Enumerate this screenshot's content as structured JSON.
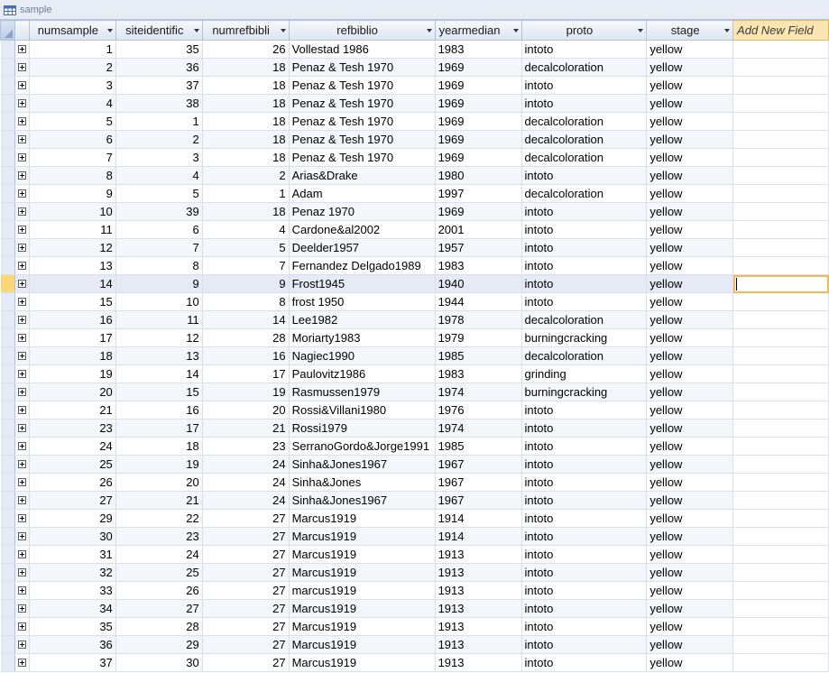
{
  "window": {
    "title": "sample"
  },
  "columns": [
    {
      "key": "numsample",
      "label": "numsample"
    },
    {
      "key": "siteidentific",
      "label": "siteidentific"
    },
    {
      "key": "numrefbibli",
      "label": "numrefbibli"
    },
    {
      "key": "refbiblio",
      "label": "refbiblio"
    },
    {
      "key": "yearmedian",
      "label": "yearmedian"
    },
    {
      "key": "proto",
      "label": "proto"
    },
    {
      "key": "stage",
      "label": "stage"
    }
  ],
  "add_field_label": "Add New Field",
  "current_row_index": 13,
  "colors": {
    "accent": "#fbd77a",
    "header": "#dce5f1",
    "add_field": "#fce5b0"
  },
  "rows": [
    [
      "1",
      "35",
      "26",
      "Vollestad 1986",
      "1983",
      "intoto",
      "yellow"
    ],
    [
      "2",
      "36",
      "18",
      "Penaz & Tesh 1970",
      "1969",
      "decalcoloration",
      "yellow"
    ],
    [
      "3",
      "37",
      "18",
      "Penaz & Tesh 1970",
      "1969",
      "intoto",
      "yellow"
    ],
    [
      "4",
      "38",
      "18",
      "Penaz & Tesh 1970",
      "1969",
      "intoto",
      "yellow"
    ],
    [
      "5",
      "1",
      "18",
      "Penaz & Tesh 1970",
      "1969",
      "decalcoloration",
      "yellow"
    ],
    [
      "6",
      "2",
      "18",
      "Penaz & Tesh 1970",
      "1969",
      "decalcoloration",
      "yellow"
    ],
    [
      "7",
      "3",
      "18",
      "Penaz & Tesh 1970",
      "1969",
      "decalcoloration",
      "yellow"
    ],
    [
      "8",
      "4",
      "2",
      "Arias&Drake",
      "1980",
      "intoto",
      "yellow"
    ],
    [
      "9",
      "5",
      "1",
      "Adam",
      "1997",
      "decalcoloration",
      "yellow"
    ],
    [
      "10",
      "39",
      "18",
      "Penaz 1970",
      "1969",
      "intoto",
      "yellow"
    ],
    [
      "11",
      "6",
      "4",
      "Cardone&al2002",
      "2001",
      "intoto",
      "yellow"
    ],
    [
      "12",
      "7",
      "5",
      "Deelder1957",
      "1957",
      "intoto",
      "yellow"
    ],
    [
      "13",
      "8",
      "7",
      "Fernandez Delgado1989",
      "1983",
      "intoto",
      "yellow"
    ],
    [
      "14",
      "9",
      "9",
      "Frost1945",
      "1940",
      "intoto",
      "yellow"
    ],
    [
      "15",
      "10",
      "8",
      "frost 1950",
      "1944",
      "intoto",
      "yellow"
    ],
    [
      "16",
      "11",
      "14",
      "Lee1982",
      "1978",
      "decalcoloration",
      "yellow"
    ],
    [
      "17",
      "12",
      "28",
      "Moriarty1983",
      "1979",
      "burningcracking",
      "yellow"
    ],
    [
      "18",
      "13",
      "16",
      "Nagiec1990",
      "1985",
      "decalcoloration",
      "yellow"
    ],
    [
      "19",
      "14",
      "17",
      "Paulovitz1986",
      "1983",
      "grinding",
      "yellow"
    ],
    [
      "20",
      "15",
      "19",
      "Rasmussen1979",
      "1974",
      "burningcracking",
      "yellow"
    ],
    [
      "21",
      "16",
      "20",
      "Rossi&Villani1980",
      "1976",
      "intoto",
      "yellow"
    ],
    [
      "23",
      "17",
      "21",
      "Rossi1979",
      "1974",
      "intoto",
      "yellow"
    ],
    [
      "24",
      "18",
      "23",
      "SerranoGordo&Jorge1991",
      "1985",
      "intoto",
      "yellow"
    ],
    [
      "25",
      "19",
      "24",
      "Sinha&Jones1967",
      "1967",
      "intoto",
      "yellow"
    ],
    [
      "26",
      "20",
      "24",
      "Sinha&Jones",
      "1967",
      "intoto",
      "yellow"
    ],
    [
      "27",
      "21",
      "24",
      "Sinha&Jones1967",
      "1967",
      "intoto",
      "yellow"
    ],
    [
      "29",
      "22",
      "27",
      "Marcus1919",
      "1914",
      "intoto",
      "yellow"
    ],
    [
      "30",
      "23",
      "27",
      "Marcus1919",
      "1914",
      "intoto",
      "yellow"
    ],
    [
      "31",
      "24",
      "27",
      "Marcus1919",
      "1913",
      "intoto",
      "yellow"
    ],
    [
      "32",
      "25",
      "27",
      "Marcus1919",
      "1913",
      "intoto",
      "yellow"
    ],
    [
      "33",
      "26",
      "27",
      "marcus1919",
      "1913",
      "intoto",
      "yellow"
    ],
    [
      "34",
      "27",
      "27",
      "Marcus1919",
      "1913",
      "intoto",
      "yellow"
    ],
    [
      "35",
      "28",
      "27",
      "Marcus1919",
      "1913",
      "intoto",
      "yellow"
    ],
    [
      "36",
      "29",
      "27",
      "Marcus1919",
      "1913",
      "intoto",
      "yellow"
    ],
    [
      "37",
      "30",
      "27",
      "Marcus1919",
      "1913",
      "intoto",
      "yellow"
    ]
  ]
}
